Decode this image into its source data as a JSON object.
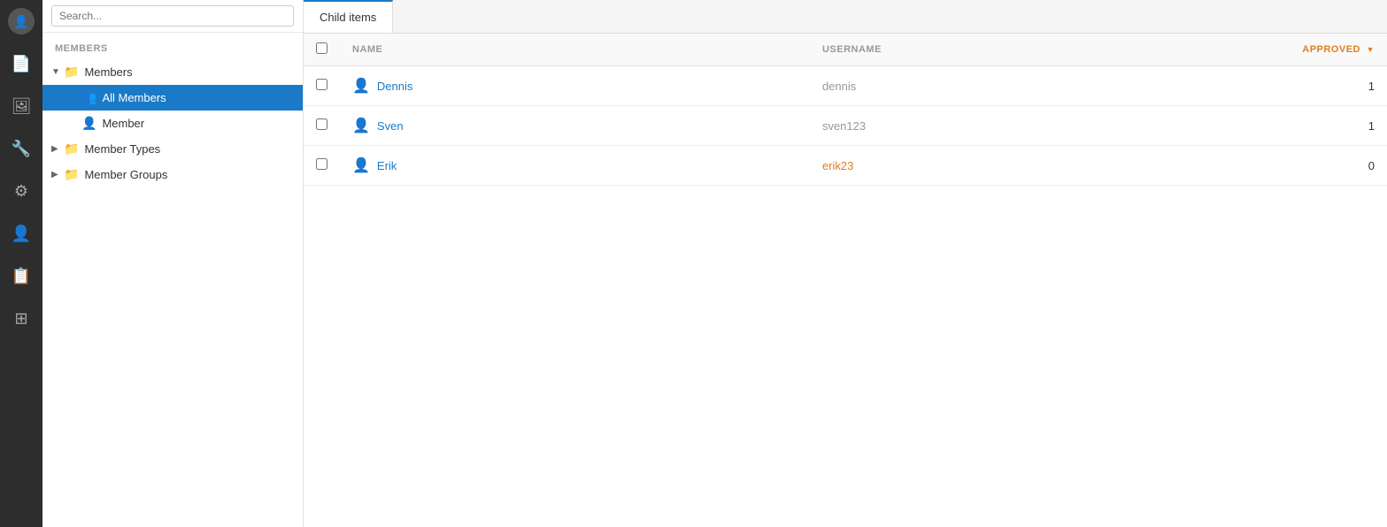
{
  "rail": {
    "icons": [
      {
        "name": "avatar-icon",
        "symbol": "👤"
      },
      {
        "name": "document-icon",
        "symbol": "📄"
      },
      {
        "name": "image-icon",
        "symbol": "🖼"
      },
      {
        "name": "tools-icon",
        "symbol": "🔧"
      },
      {
        "name": "settings-icon",
        "symbol": "⚙"
      },
      {
        "name": "user-icon",
        "symbol": "👤"
      },
      {
        "name": "list-icon",
        "symbol": "📋"
      },
      {
        "name": "table-icon",
        "symbol": "⊞"
      }
    ]
  },
  "sidebar": {
    "search_placeholder": "Search...",
    "section_label": "MEMBERS",
    "tree": {
      "members": {
        "label": "Members",
        "children": [
          {
            "label": "All Members",
            "active": true
          },
          {
            "label": "Member"
          }
        ]
      },
      "member_types": {
        "label": "Member Types"
      },
      "member_groups": {
        "label": "Member Groups"
      }
    }
  },
  "tabs": [
    {
      "label": "Child items",
      "active": true
    }
  ],
  "table": {
    "columns": [
      {
        "key": "name",
        "label": "NAME",
        "sorted": false
      },
      {
        "key": "username",
        "label": "USERNAME",
        "sorted": false
      },
      {
        "key": "approved",
        "label": "APPROVED",
        "sorted": true,
        "sort_dir": "desc"
      }
    ],
    "rows": [
      {
        "name": "Dennis",
        "username": "dennis",
        "approved": "1",
        "username_linked": false
      },
      {
        "name": "Sven",
        "username": "sven123",
        "approved": "1",
        "username_linked": false
      },
      {
        "name": "Erik",
        "username": "erik23",
        "approved": "0",
        "username_linked": true
      }
    ]
  }
}
